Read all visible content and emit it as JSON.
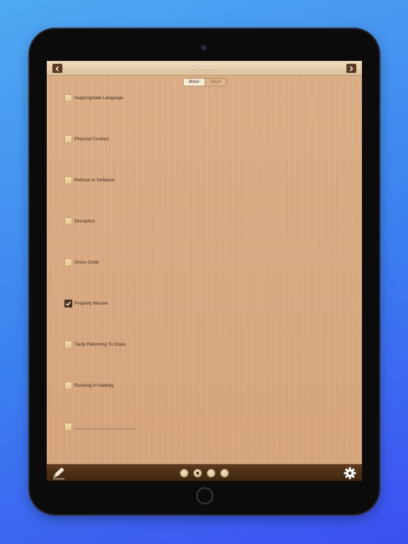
{
  "app": {
    "title": "O.D.R.",
    "back_icon": "chevron-left-icon",
    "forward_icon": "chevron-right-icon"
  },
  "segment": {
    "options": [
      "Minor",
      "Major"
    ],
    "selected": "Minor"
  },
  "items": [
    {
      "label": "Inappropriate Language",
      "checked": false
    },
    {
      "label": "Physical Contact",
      "checked": false
    },
    {
      "label": "Refusal or Defiance",
      "checked": false
    },
    {
      "label": "Disruption",
      "checked": false
    },
    {
      "label": "Dress Code",
      "checked": false
    },
    {
      "label": "Property Misuse",
      "checked": true
    },
    {
      "label": "Tardy Returning To Class",
      "checked": false
    },
    {
      "label": "Running in Hallway",
      "checked": false
    },
    {
      "label": "",
      "checked": false
    }
  ],
  "bottombar": {
    "left_icon": "pencil-icon",
    "right_icon": "gear-icon",
    "page_count": 4,
    "current_page": 2
  },
  "colors": {
    "background_top": "#4fa9f2",
    "background_bottom": "#3d4ff2",
    "wood": "#d9ab84",
    "bar_brown": "#4f3118"
  }
}
